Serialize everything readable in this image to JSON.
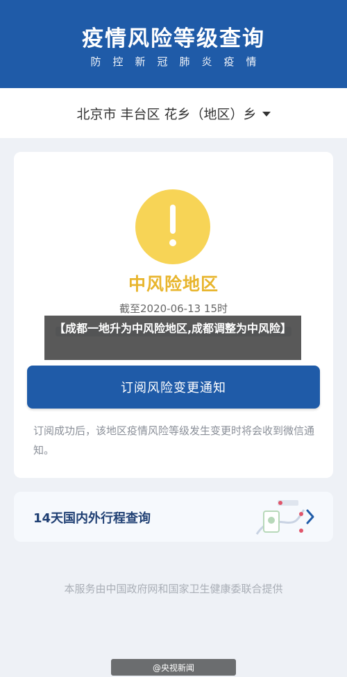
{
  "header": {
    "title": "疫情风险等级查询",
    "subtitle": "防控新冠肺炎疫情"
  },
  "location": {
    "selected": "北京市 丰台区 花乡（地区）乡"
  },
  "risk": {
    "level": "中风险地区",
    "cutoff": "截至2020-06-13 15时"
  },
  "subscribe": {
    "button_label": "订阅风险变更通知",
    "note": "订阅成功后，该地区疫情风险等级发生变更时将会收到微信通知。"
  },
  "trip_query": {
    "label": "14天国内外行程查询"
  },
  "footer": {
    "text": "本服务由中国政府网和国家卫生健康委联合提供"
  },
  "overlay": {
    "headline": "【成都一地升为中风险地区,成都调整为中风险】",
    "watermark": "@央视新闻"
  },
  "colors": {
    "brand_blue": "#1f5ba8",
    "risk_yellow": "#f7d456",
    "risk_text": "#e8b52d"
  }
}
